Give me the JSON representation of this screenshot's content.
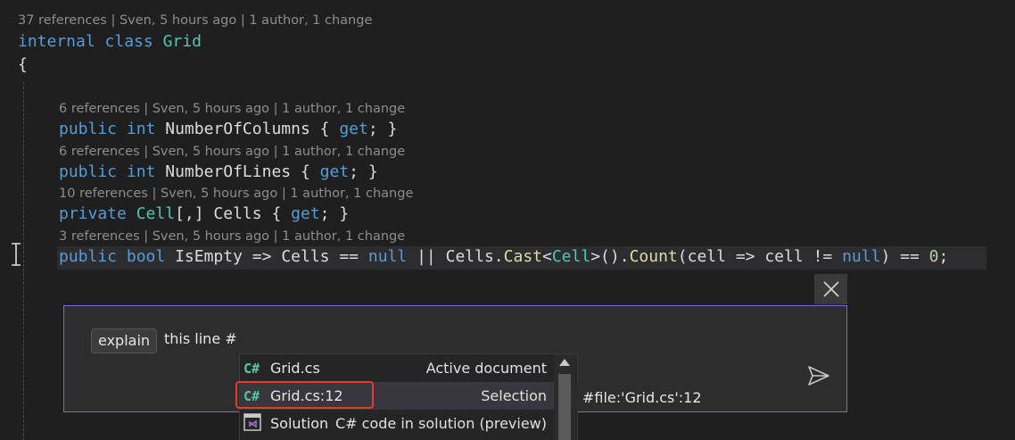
{
  "class_lens": "37 references | Sven, 5 hours ago | 1 author, 1 change",
  "class_decl": {
    "kw1": "internal",
    "kw2": "class",
    "name": "Grid"
  },
  "open_brace": "{",
  "members": [
    {
      "lens": "6 references | Sven, 5 hours ago | 1 author, 1 change",
      "modifier": "public",
      "type": "int",
      "name": "NumberOfColumns",
      "body_open": "{",
      "accessor": "get",
      "body_close": "; }"
    },
    {
      "lens": "6 references | Sven, 5 hours ago | 1 author, 1 change",
      "modifier": "public",
      "type": "int",
      "name": "NumberOfLines",
      "body_open": "{",
      "accessor": "get",
      "body_close": "; }"
    },
    {
      "lens": "10 references | Sven, 5 hours ago | 1 author, 1 change",
      "modifier": "private",
      "type": "Cell",
      "type_suffix": "[,]",
      "name": "Cells",
      "body_open": "{",
      "accessor": "get",
      "body_close": "; }"
    }
  ],
  "isempty": {
    "lens": "3 references | Sven, 5 hours ago | 1 author, 1 change",
    "modifier": "public",
    "type": "bool",
    "name": "IsEmpty",
    "arrow": "=>",
    "cells": "Cells",
    "eq": "==",
    "null1": "null",
    "or": "||",
    "cells2": "Cells",
    "dot1": ".",
    "cast": "Cast",
    "lt": "<",
    "cell_type": "Cell",
    "gt": ">",
    "paren": "()",
    "dot2": ".",
    "count": "Count",
    "popen": "(",
    "param": "cell",
    "arrow2": "=>",
    "param2": "cell",
    "neq": "!=",
    "null2": "null",
    "pclose": ")",
    "eq2": "==",
    "zero": "0",
    "semi": ";"
  },
  "chat": {
    "chip_label": "explain",
    "prompt_text": "this line #",
    "close_icon": "close-icon",
    "send_icon": "send-icon"
  },
  "dropdown": {
    "items": [
      {
        "icon": "C#",
        "name": "Grid.cs",
        "desc": "Active document"
      },
      {
        "icon": "C#",
        "name": "Grid.cs:12",
        "desc": "Selection"
      },
      {
        "icon": "solution-icon",
        "name": "Solution",
        "desc": "C# code in solution (preview)"
      }
    ]
  },
  "tooltip": "#file:'Grid.cs':12",
  "colors": {
    "background": "#1f1f1f",
    "keyword": "#569cd6",
    "type": "#4ec9b0",
    "member": "#dcdcaa",
    "number": "#b5cea8",
    "chat_border": "#7b6ad6",
    "highlight": "#e53935"
  }
}
